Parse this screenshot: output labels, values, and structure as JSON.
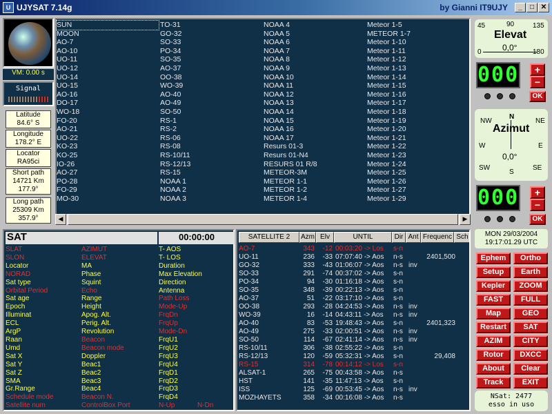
{
  "window": {
    "title": "UJYSAT 7.14g",
    "author": "by Gianni IT9UJY",
    "min_label": "_",
    "max_label": "□",
    "close_label": "✕"
  },
  "left": {
    "vm": "VM: 0.00 s",
    "signal_label": "Signal",
    "latitude_label": "Latitude",
    "latitude_value": "84.6° S",
    "longitude_label": "Longitude",
    "longitude_value": "178.2° E",
    "locator_label": "Locator",
    "locator_value": "RA95ci",
    "short_path_label": "Short path",
    "short_path_km": "14721 Km",
    "short_path_deg": "177.9°",
    "long_path_label": "Long path",
    "long_path_km": "25309 Km",
    "long_path_deg": "357.9°"
  },
  "satlist": {
    "col1": [
      "SUN",
      "MOON",
      "AO-7",
      "AO-10",
      "UO-11",
      "UO-12",
      "UO-14",
      "UO-15",
      "AO-16",
      "DO-17",
      "WO-18",
      "FO-20",
      "AO-21",
      "UO-22",
      "KO-23",
      "KO-25",
      "IO-26",
      "AO-27",
      "PO-28",
      "FO-29",
      "MO-30"
    ],
    "col2": [
      "TO-31",
      "GO-32",
      "SO-33",
      "PO-34",
      "SO-35",
      "AO-37",
      "OO-38",
      "WO-39",
      "AO-40",
      "AO-49",
      "SO-50",
      "RS-1",
      "RS-2",
      "RS-06",
      "RS-08",
      "RS-10/11",
      "RS-12/13",
      "RS-15",
      "NOAA 1",
      "NOAA 2",
      "NOAA 3"
    ],
    "col3": [
      "NOAA 4",
      "NOAA 5",
      "NOAA 6",
      "NOAA 7",
      "NOAA 8",
      "NOAA 9",
      "NOAA 10",
      "NOAA 11",
      "NOAA 12",
      "NOAA 13",
      "NOAA 14",
      "NOAA 15",
      "NOAA 16",
      "NOAA 17",
      "Resurs 01-3",
      "Resurs 01-N4",
      "RESURS 01 R/8",
      "METEOR-3M",
      "METEOR 1-1",
      "METEOR 1-2",
      "METEOR 1-4"
    ],
    "col4": [
      "Meteor 1-5",
      "METEOR 1-7",
      "Meteor 1-10",
      "Meteor 1-11",
      "Meteor 1-12",
      "Meteor 1-13",
      "Meteor 1-14",
      "Meteor 1-15",
      "Meteor 1-16",
      "Meteor 1-17",
      "Meteor 1-18",
      "Meteor 1-19",
      "Meteor 1-20",
      "Meteor 1-21",
      "Meteor 1-22",
      "Meteor 1-23",
      "Meteor 1-24",
      "Meteor 1-25",
      "Meteor 1-26",
      "Meteor 1-27",
      "Meteor 1-29"
    ],
    "scroll_left": "◀",
    "scroll_right": "▶"
  },
  "elevation": {
    "title": "Elevat",
    "tick_45": "45",
    "tick_90": "90",
    "tick_135": "135",
    "tick_0": "0",
    "tick_180": "180",
    "value": "0,0°",
    "digits": "000",
    "plus": "+",
    "minus": "−",
    "ok": "OK"
  },
  "azimuth": {
    "title": "Azimut",
    "n": "N",
    "nw": "NW",
    "ne": "NE",
    "w": "W",
    "e": "E",
    "sw": "SW",
    "s": "S",
    "se": "SE",
    "value": "0,0°",
    "digits": "000",
    "plus": "+",
    "minus": "−",
    "ok": "OK"
  },
  "datetime": {
    "date": "MON 29/03/2004",
    "time": "19:17:01.29 UTC"
  },
  "buttons": [
    "Ephem",
    "Ortho",
    "Setup",
    "Earth",
    "Kepler",
    "ZOOM",
    "FAST",
    "FULL",
    "Map",
    "GEO",
    "Restart",
    "SAT",
    "AZIM",
    "CITY",
    "Rotor",
    "DXCC",
    "About",
    "Clear",
    "Track",
    "EXIT"
  ],
  "nsat": {
    "line1": "NSat: 2477",
    "line2": "esso in uso"
  },
  "satpanel": {
    "name": "SAT",
    "clock": "00:00:00",
    "col1": [
      {
        "t": "SLAT",
        "c": "red"
      },
      {
        "t": "SLON",
        "c": "red"
      },
      {
        "t": "Locator",
        "c": "yel"
      },
      {
        "t": "NORAD",
        "c": "red"
      },
      {
        "t": "Sat type",
        "c": "yel"
      },
      {
        "t": "Orbital Period",
        "c": "red"
      },
      {
        "t": "Sat age",
        "c": "yel"
      },
      {
        "t": "Epoch",
        "c": "yel"
      },
      {
        "t": "Illuminat",
        "c": "yel"
      },
      {
        "t": "ECL",
        "c": "yel"
      },
      {
        "t": "ArgP",
        "c": "yel"
      },
      {
        "t": "Raan",
        "c": "yel"
      },
      {
        "t": "Umd",
        "c": "yel"
      },
      {
        "t": "Sat X",
        "c": "yel"
      },
      {
        "t": "Sat Y",
        "c": "yel"
      },
      {
        "t": "Sat Z",
        "c": "yel"
      },
      {
        "t": "SMA",
        "c": "yel"
      },
      {
        "t": "Gr.Range",
        "c": "yel"
      },
      {
        "t": "Schedule mode",
        "c": "red"
      },
      {
        "t": "Satellite num",
        "c": "red"
      }
    ],
    "col2": [
      {
        "t": "AZIMUT",
        "c": "red"
      },
      {
        "t": "ELEVAT",
        "c": "red"
      },
      {
        "t": "MA",
        "c": "yel"
      },
      {
        "t": "Phase",
        "c": "yel"
      },
      {
        "t": "Squint",
        "c": "yel"
      },
      {
        "t": "Echo",
        "c": "red"
      },
      {
        "t": "Range",
        "c": "yel"
      },
      {
        "t": "Height",
        "c": "yel"
      },
      {
        "t": "Apog. Alt.",
        "c": "yel"
      },
      {
        "t": "Perig. Alt.",
        "c": "yel"
      },
      {
        "t": "Revolution",
        "c": "yel"
      },
      {
        "t": "Beacon",
        "c": "red"
      },
      {
        "t": "Beacon mode",
        "c": "red"
      },
      {
        "t": "Doppler",
        "c": "yel"
      },
      {
        "t": "Beac1",
        "c": "yel"
      },
      {
        "t": "Beac2",
        "c": "yel"
      },
      {
        "t": "Beac3",
        "c": "yel"
      },
      {
        "t": "Beac4",
        "c": "yel"
      },
      {
        "t": "Beacon N.",
        "c": "red"
      },
      {
        "t": "ControlBox Port",
        "c": "red"
      }
    ],
    "col3": [
      {
        "t": "T- AOS",
        "c": "yel"
      },
      {
        "t": "T- LOS",
        "c": "yel"
      },
      {
        "t": "Duration",
        "c": "yel"
      },
      {
        "t": "Max Elevation",
        "c": "yel"
      },
      {
        "t": "Direction",
        "c": "yel"
      },
      {
        "t": "Antenna",
        "c": "yel"
      },
      {
        "t": "Path Loss",
        "c": "red"
      },
      {
        "t": "Mode-Up",
        "c": "red"
      },
      {
        "t": "FrqDn",
        "c": "red"
      },
      {
        "t": "FrqUp",
        "c": "red"
      },
      {
        "t": "Mode-Dn",
        "c": "red"
      },
      {
        "t": "FrqU1",
        "c": "yel"
      },
      {
        "t": "FrqU2",
        "c": "yel"
      },
      {
        "t": "FrqU3",
        "c": "yel"
      },
      {
        "t": "FrqU4",
        "c": "yel"
      },
      {
        "t": "FrqD1",
        "c": "yel"
      },
      {
        "t": "FrqD2",
        "c": "yel"
      },
      {
        "t": "FrqD3",
        "c": "yel"
      },
      {
        "t": "FrqD4",
        "c": "yel"
      },
      {
        "t": "N-Up",
        "c": "red"
      }
    ],
    "extra": {
      "t": "N-Dn",
      "c": "red"
    }
  },
  "passtable": {
    "headers": [
      "SATELLITE  2",
      "Azm",
      "Elv",
      "UNTIL",
      "Dir",
      "Ant",
      "Frequenc",
      "Sch"
    ],
    "rows": [
      {
        "sat": "AO-7",
        "azm": "343",
        "elv": "-12",
        "until": "00:03:20 -> Los",
        "dir": "s-n",
        "ant": "",
        "freq": "",
        "red": true
      },
      {
        "sat": "UO-11",
        "azm": "236",
        "elv": "-33",
        "until": "07:07:40 -> Aos",
        "dir": "n-s",
        "ant": "",
        "freq": "2401,500",
        "red": false
      },
      {
        "sat": "GO-32",
        "azm": "333",
        "elv": "-43",
        "until": "01:06:07 -> Aos",
        "dir": "n-s",
        "ant": "inv",
        "freq": "",
        "red": false
      },
      {
        "sat": "SO-33",
        "azm": "291",
        "elv": "-74",
        "until": "00:37:02 -> Aos",
        "dir": "s-n",
        "ant": "",
        "freq": "",
        "red": false
      },
      {
        "sat": "PO-34",
        "azm": "94",
        "elv": "-30",
        "until": "01:16:18 -> Aos",
        "dir": "s-n",
        "ant": "",
        "freq": "",
        "red": false
      },
      {
        "sat": "SO-35",
        "azm": "348",
        "elv": "-39",
        "until": "00:22:13 -> Aos",
        "dir": "s-n",
        "ant": "",
        "freq": "",
        "red": false
      },
      {
        "sat": "AO-37",
        "azm": "51",
        "elv": "-22",
        "until": "03:17:10 -> Aos",
        "dir": "s-n",
        "ant": "",
        "freq": "",
        "red": false
      },
      {
        "sat": "OO-38",
        "azm": "293",
        "elv": "-28",
        "until": "04:24:53 -> Aos",
        "dir": "n-s",
        "ant": "inv",
        "freq": "",
        "red": false
      },
      {
        "sat": "WO-39",
        "azm": "16",
        "elv": "-14",
        "until": "04:43:11 -> Aos",
        "dir": "n-s",
        "ant": "inv",
        "freq": "",
        "red": false
      },
      {
        "sat": "AO-40",
        "azm": "83",
        "elv": "-53",
        "until": "19:48:43 -> Aos",
        "dir": "s-n",
        "ant": "",
        "freq": "2401,323",
        "red": false
      },
      {
        "sat": "AO-49",
        "azm": "275",
        "elv": "-33",
        "until": "02:00:51 -> Aos",
        "dir": "n-s",
        "ant": "inv",
        "freq": "",
        "red": false
      },
      {
        "sat": "SO-50",
        "azm": "114",
        "elv": "-67",
        "until": "02:41:14 -> Aos",
        "dir": "n-s",
        "ant": "inv",
        "freq": "",
        "red": false
      },
      {
        "sat": "RS-10/11",
        "azm": "306",
        "elv": "-38",
        "until": "02:55:22 -> Aos",
        "dir": "s-n",
        "ant": "",
        "freq": "",
        "red": false
      },
      {
        "sat": "RS-12/13",
        "azm": "120",
        "elv": "-59",
        "until": "05:32:31 -> Aos",
        "dir": "s-n",
        "ant": "",
        "freq": "29,408",
        "red": false
      },
      {
        "sat": "RS-15",
        "azm": "314",
        "elv": "-78",
        "until": "00:14:12 -> Los",
        "dir": "s-n",
        "ant": "",
        "freq": "",
        "red": true
      },
      {
        "sat": "ALSAT-1",
        "azm": "265",
        "elv": "-75",
        "until": "00:43:58 -> Aos",
        "dir": "n-s",
        "ant": "",
        "freq": "",
        "red": false
      },
      {
        "sat": "HST",
        "azm": "141",
        "elv": "-35",
        "until": "11:47:13 -> Aos",
        "dir": "s-n",
        "ant": "",
        "freq": "",
        "red": false
      },
      {
        "sat": "ISS",
        "azm": "125",
        "elv": "-69",
        "until": "00:53:45 -> Aos",
        "dir": "n-s",
        "ant": "inv",
        "freq": "",
        "red": false
      },
      {
        "sat": "MOZHAYETS",
        "azm": "358",
        "elv": "-34",
        "until": "00:16:08 -> Aos",
        "dir": "n-s",
        "ant": "",
        "freq": "",
        "red": false
      }
    ]
  }
}
